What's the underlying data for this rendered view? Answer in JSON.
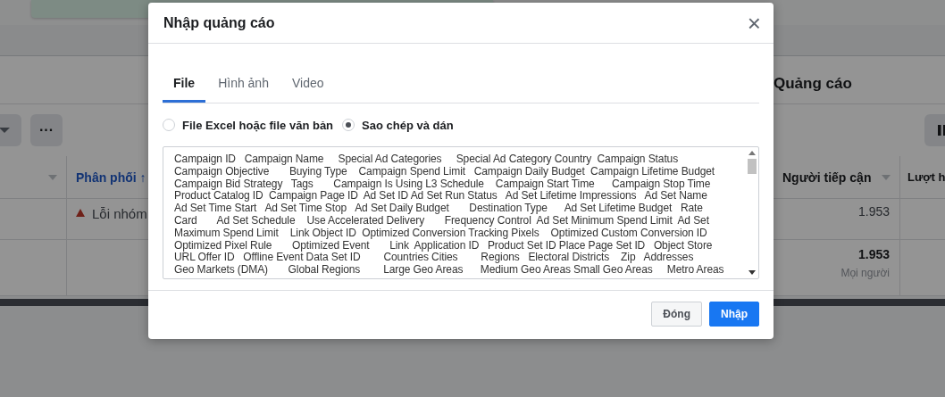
{
  "background": {
    "section_title": "Quảng cáo",
    "more_button": "···",
    "columns": [
      {
        "label": "Phân phối ↑",
        "sorted": true
      },
      {
        "label": "Người tiếp cận",
        "sorted": false
      },
      {
        "label": "Lượt h",
        "sorted": false
      }
    ],
    "rows": [
      {
        "delivery": "Lỗi nhóm",
        "warning": true,
        "reach": "1.953",
        "note": ""
      },
      {
        "delivery": "",
        "warning": false,
        "reach": "1.953",
        "note": "Mọi người"
      }
    ]
  },
  "dialog": {
    "title": "Nhập quảng cáo",
    "close": "×",
    "tabs": [
      {
        "label": "File",
        "selected": true
      },
      {
        "label": "Hình ảnh",
        "selected": false
      },
      {
        "label": "Video",
        "selected": false
      }
    ],
    "options": [
      {
        "label": "File Excel hoặc file văn bản",
        "selected": false
      },
      {
        "label": "Sao chép và dán",
        "selected": true
      }
    ],
    "text_lines": [
      "Campaign ID   Campaign Name     Special Ad Categories     Special Ad Category Country  Campaign Status",
      "Campaign Objective       Buying Type    Campaign Spend Limit   Campaign Daily Budget  Campaign Lifetime Budget",
      "Campaign Bid Strategy   Tags       Campaign Is Using L3 Schedule    Campaign Start Time      Campaign Stop Time",
      "Product Catalog ID  Campaign Page ID  Ad Set ID Ad Set Run Status   Ad Set Lifetime Impressions   Ad Set Name",
      "Ad Set Time Start   Ad Set Time Stop   Ad Set Daily Budget       Destination Type      Ad Set Lifetime Budget   Rate",
      "Card       Ad Set Schedule    Use Accelerated Delivery       Frequency Control  Ad Set Minimum Spend Limit  Ad Set",
      "Maximum Spend Limit    Link Object ID  Optimized Conversion Tracking Pixels    Optimized Custom Conversion ID",
      "Optimized Pixel Rule       Optimized Event       Link  Application ID   Product Set ID Place Page Set ID   Object Store",
      "URL Offer ID   Offline Event Data Set ID        Countries Cities        Regions   Electoral Districts    Zip   Addresses",
      "Geo Markets (DMA)       Global Regions        Large Geo Areas      Medium Geo Areas Small Geo Areas     Metro Areas"
    ],
    "buttons": [
      {
        "label": "Đóng",
        "kind": "secondary"
      },
      {
        "label": "Nhập",
        "kind": "primary"
      }
    ]
  }
}
